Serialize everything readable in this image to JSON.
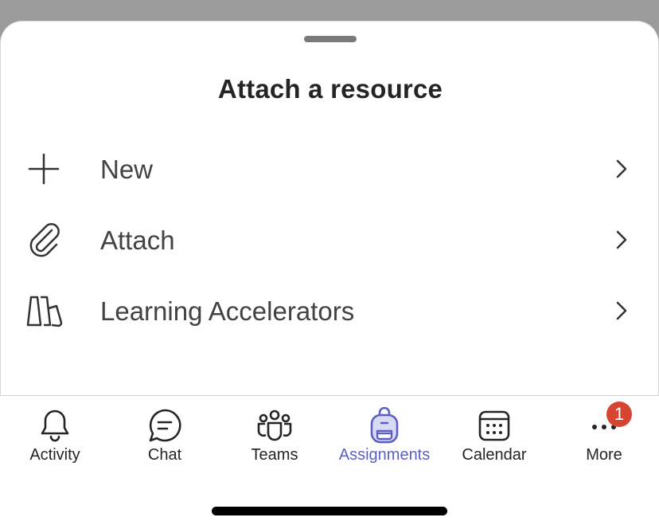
{
  "sheet": {
    "title": "Attach a resource",
    "options": [
      {
        "label": "New",
        "icon": "plus-icon"
      },
      {
        "label": "Attach",
        "icon": "paperclip-icon"
      },
      {
        "label": "Learning Accelerators",
        "icon": "learning-accelerators-icon"
      }
    ]
  },
  "tabbar": {
    "tabs": [
      {
        "label": "Activity",
        "icon": "bell-icon"
      },
      {
        "label": "Chat",
        "icon": "chat-icon"
      },
      {
        "label": "Teams",
        "icon": "teams-icon"
      },
      {
        "label": "Assignments",
        "icon": "backpack-icon",
        "active": true
      },
      {
        "label": "Calendar",
        "icon": "calendar-icon"
      },
      {
        "label": "More",
        "icon": "more-icon",
        "badge": "1"
      }
    ]
  },
  "colors": {
    "accent": "#5b5fc7",
    "badge": "#d64531",
    "text": "#242424",
    "backdrop": "#9b9b9b"
  }
}
